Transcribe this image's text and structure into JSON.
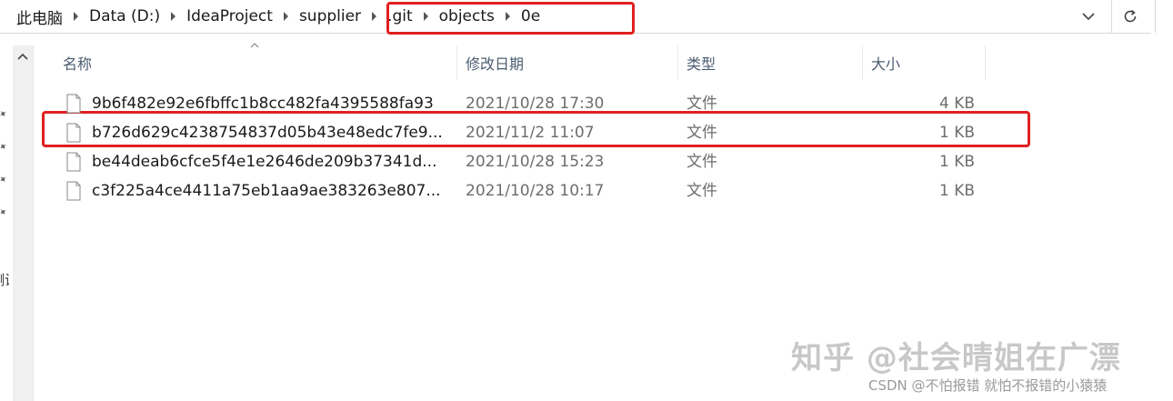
{
  "address_bar": {
    "crumbs": [
      "此电脑",
      "Data (D:)",
      "IdeaProject",
      "supplier",
      ".git",
      "objects",
      "0e"
    ]
  },
  "columns": {
    "name": "名称",
    "date": "修改日期",
    "type": "类型",
    "size": "大小"
  },
  "files": [
    {
      "name": "9b6f482e92e6fbffc1b8cc482fa4395588fa93",
      "date": "2021/10/28 17:30",
      "type": "文件",
      "size": "4 KB"
    },
    {
      "name": "b726d629c4238754837d05b43e48edc7fe9...",
      "date": "2021/11/2 11:07",
      "type": "文件",
      "size": "1 KB"
    },
    {
      "name": "be44deab6cfce5f4e1e2646de209b37341d...",
      "date": "2021/10/28 15:23",
      "type": "文件",
      "size": "1 KB"
    },
    {
      "name": "c3f225a4ce4411a75eb1aa9ae383263e807...",
      "date": "2021/10/28 10:17",
      "type": "文件",
      "size": "1 KB"
    }
  ],
  "nav_fragment": "测试",
  "watermarks": {
    "zhihu": "知乎 @社会晴姐在广漂",
    "csdn": "CSDN @不怕报错 就怕不报错的小猿猿"
  },
  "icons": {
    "dropdown": "chevron-down-icon",
    "refresh": "refresh-icon",
    "file": "file-icon",
    "pin": "pin-icon",
    "scroll_up": "scroll-up-icon",
    "sort": "sort-ascending-icon"
  },
  "colors": {
    "highlight": "#e02020",
    "header_text": "#4b5c70",
    "secondary_text": "#6d6d6d"
  }
}
